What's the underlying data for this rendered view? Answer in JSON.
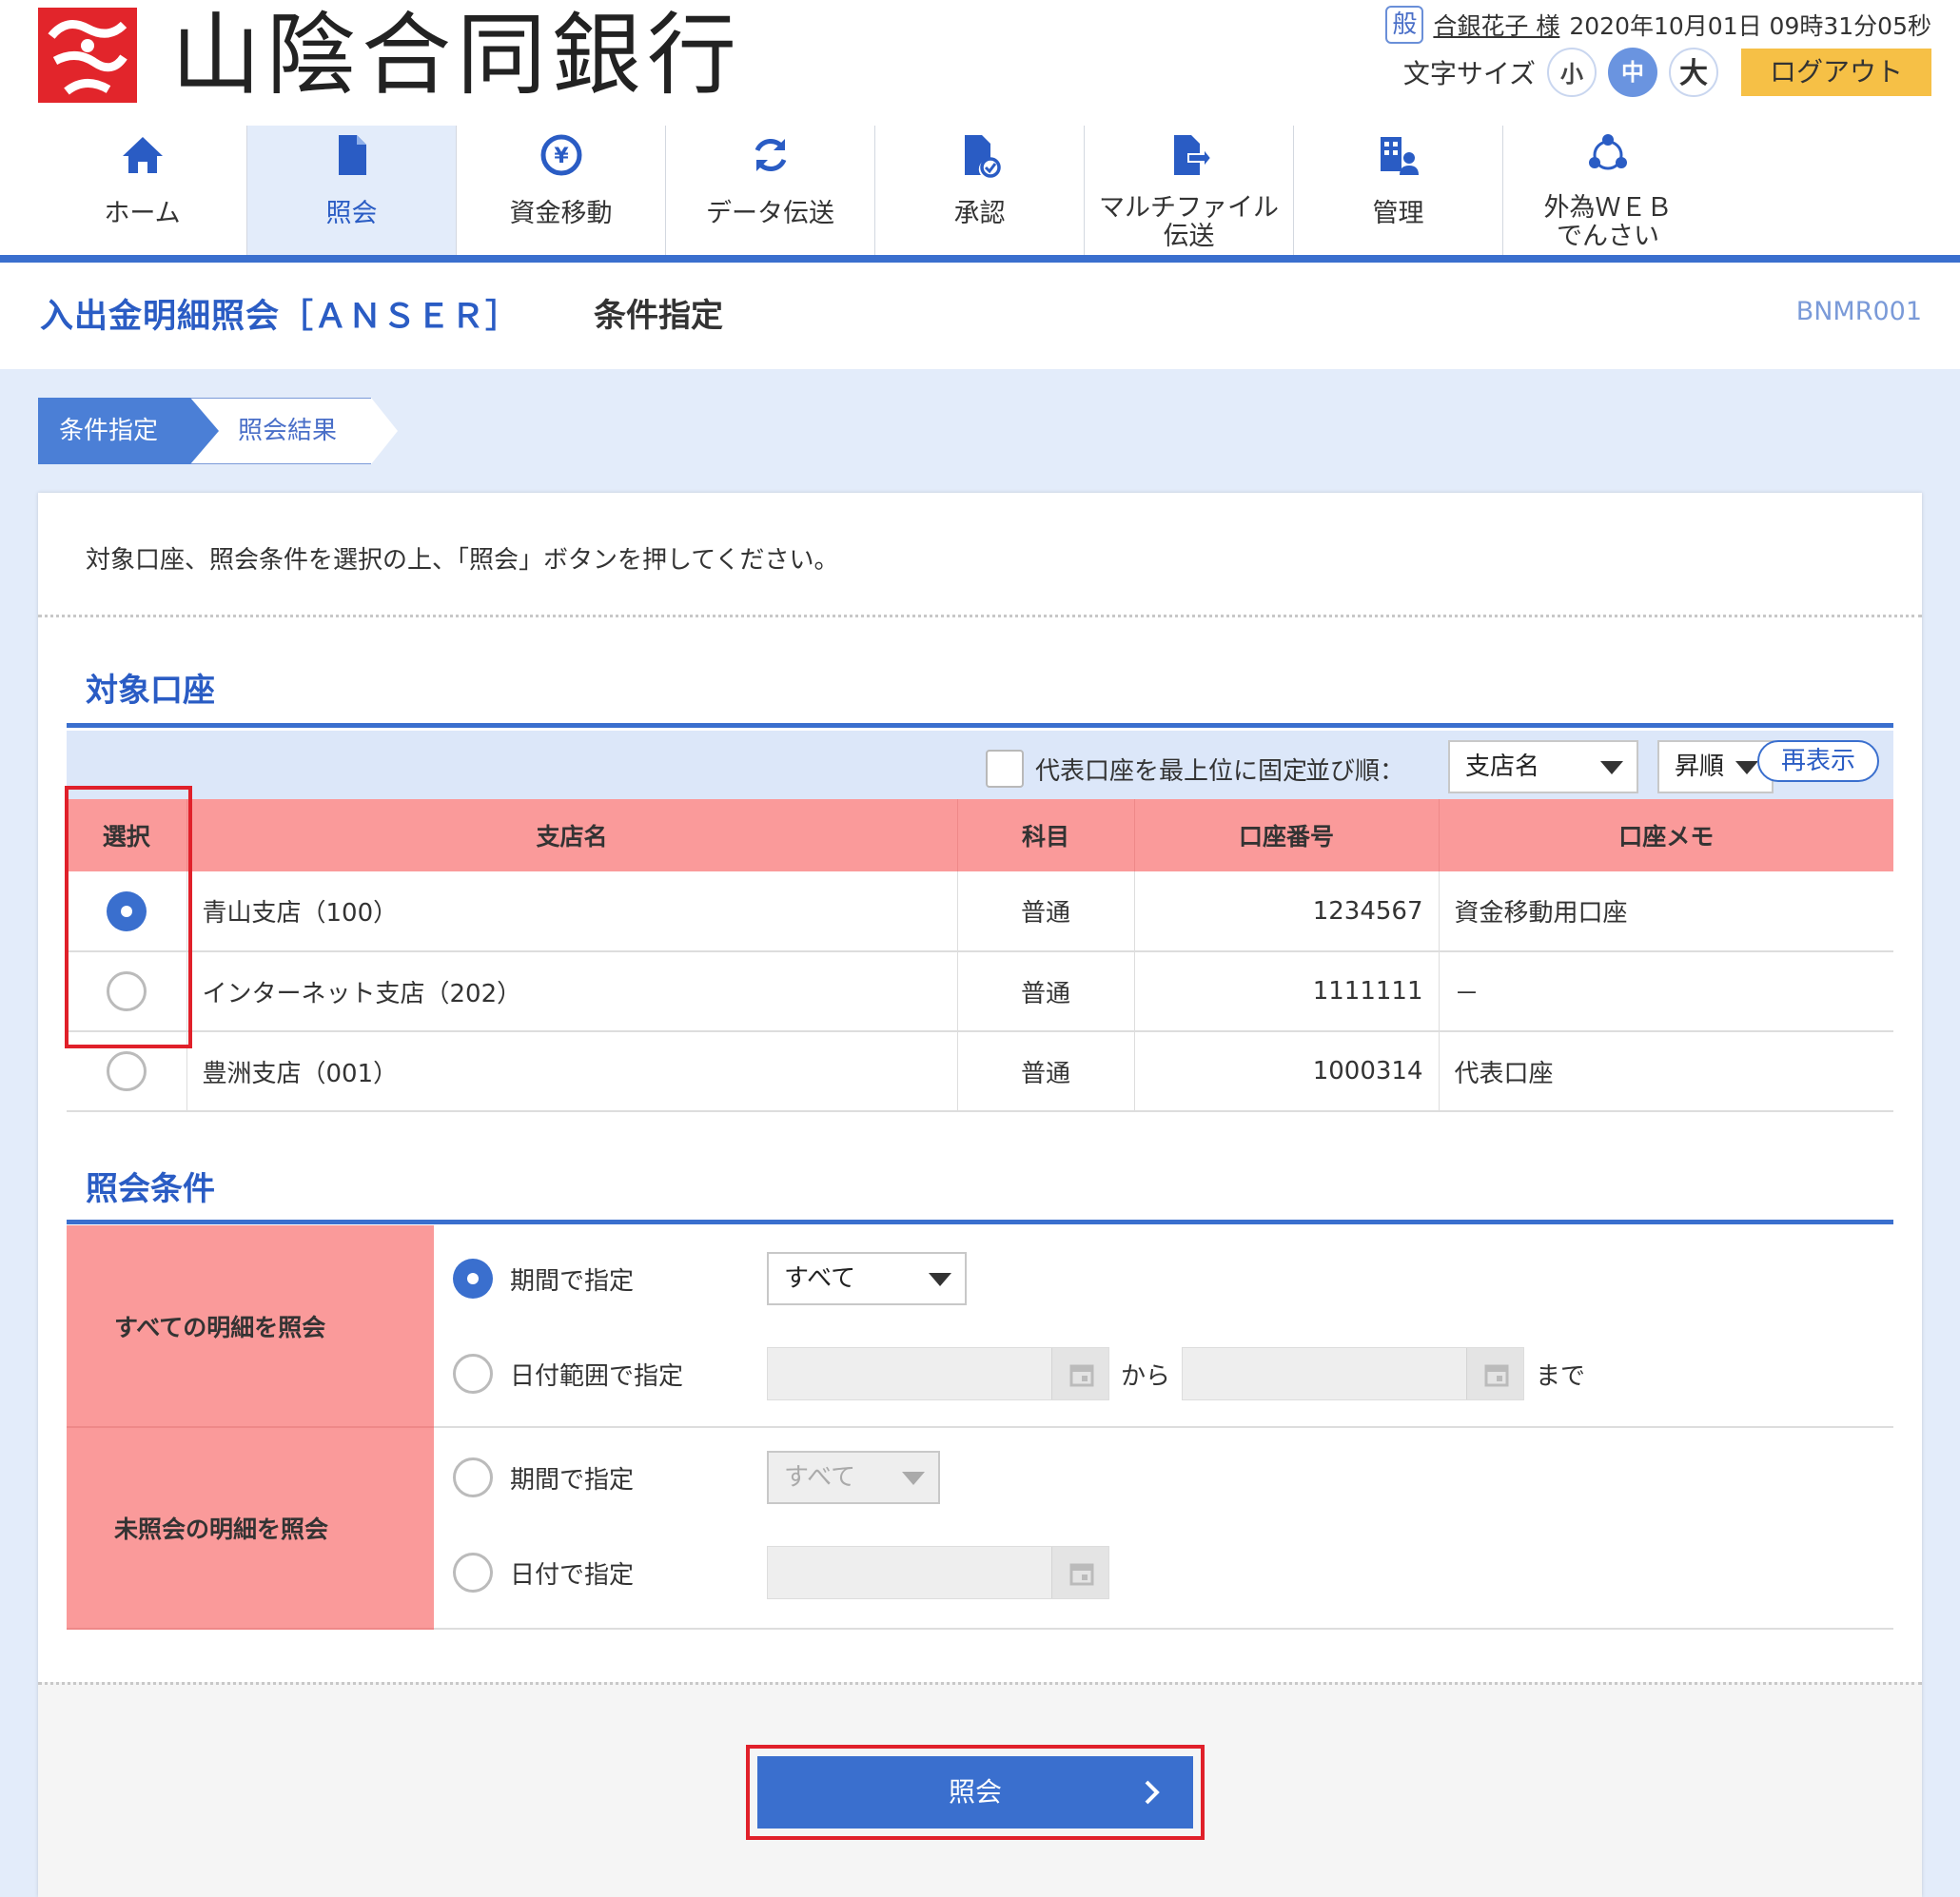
{
  "header": {
    "bank_name": "山陰合同銀行",
    "user_badge": "般",
    "user_name": "合銀花子 様",
    "datetime": "2020年10月01日 09時31分05秒",
    "font_size_label": "文字サイズ",
    "font_small": "小",
    "font_medium": "中",
    "font_large": "大",
    "logout": "ログアウト"
  },
  "nav": {
    "items": [
      {
        "label": "ホーム",
        "icon": "home-icon"
      },
      {
        "label": "照会",
        "icon": "document-icon"
      },
      {
        "label": "資金移動",
        "icon": "yen-transfer-icon"
      },
      {
        "label": "データ伝送",
        "icon": "refresh-icon"
      },
      {
        "label": "承認",
        "icon": "approve-document-icon"
      },
      {
        "label1": "マルチファイル",
        "label2": "伝送",
        "icon": "file-send-icon"
      },
      {
        "label": "管理",
        "icon": "admin-icon"
      },
      {
        "label1": "外為ＷＥＢ",
        "label2": "でんさい",
        "icon": "network-icon"
      }
    ],
    "active_index": 1
  },
  "page": {
    "title": "入出金明細照会［ＡＮＳＥＲ］",
    "subtitle": "条件指定",
    "screen_id": "BNMR001"
  },
  "steps": {
    "step1": "条件指定",
    "step2": "照会結果"
  },
  "instruction": "対象口座、照会条件を選択の上、「照会」ボタンを押してください。",
  "accounts": {
    "section_title": "対象口座",
    "pin_label": "代表口座を最上位に固定",
    "pin_checked": false,
    "sort_label": "並び順：",
    "sort_field": "支店名",
    "sort_order": "昇順",
    "redisplay": "再表示",
    "columns": [
      "選択",
      "支店名",
      "科目",
      "口座番号",
      "口座メモ"
    ],
    "rows": [
      {
        "selected": true,
        "branch": "青山支店（100）",
        "type": "普通",
        "number": "1234567",
        "memo": "資金移動用口座"
      },
      {
        "selected": false,
        "branch": "インターネット支店（202）",
        "type": "普通",
        "number": "1111111",
        "memo": "－"
      },
      {
        "selected": false,
        "branch": "豊洲支店（001）",
        "type": "普通",
        "number": "1000314",
        "memo": "代表口座"
      }
    ]
  },
  "conditions": {
    "section_title": "照会条件",
    "all": {
      "label": "すべての明細を照会",
      "period_label": "期間で指定",
      "period_value": "すべて",
      "range_label": "日付範囲で指定",
      "from": "から",
      "to": "まで"
    },
    "unread": {
      "label": "未照会の明細を照会",
      "period_label": "期間で指定",
      "period_value": "すべて",
      "date_label": "日付で指定"
    }
  },
  "submit": "照会"
}
